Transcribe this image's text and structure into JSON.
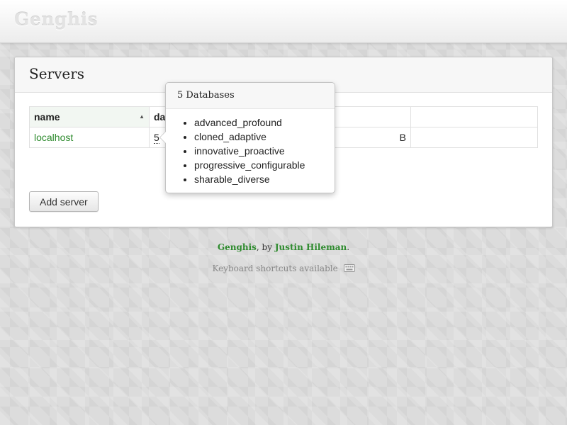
{
  "app": {
    "logo": "Genghis"
  },
  "panel": {
    "title": "Servers",
    "table": {
      "columns": [
        "name",
        "dat",
        "",
        ""
      ],
      "rows": [
        {
          "name": "localhost",
          "databases": "5",
          "col3": "B",
          "col4": ""
        }
      ]
    },
    "add_server_label": "Add server"
  },
  "popover": {
    "title": "5 Databases",
    "items": [
      "advanced_profound",
      "cloned_adaptive",
      "innovative_proactive",
      "progressive_configurable",
      "sharable_diverse"
    ]
  },
  "footer": {
    "app_name": "Genghis",
    "by": ", by ",
    "author": "Justin Hileman",
    "period": ".",
    "shortcuts": "Keyboard shortcuts available"
  },
  "icons": {
    "sort": "sort-ascending-icon",
    "keyboard": "keyboard-icon"
  },
  "colors": {
    "link": "#2e8b2e"
  }
}
